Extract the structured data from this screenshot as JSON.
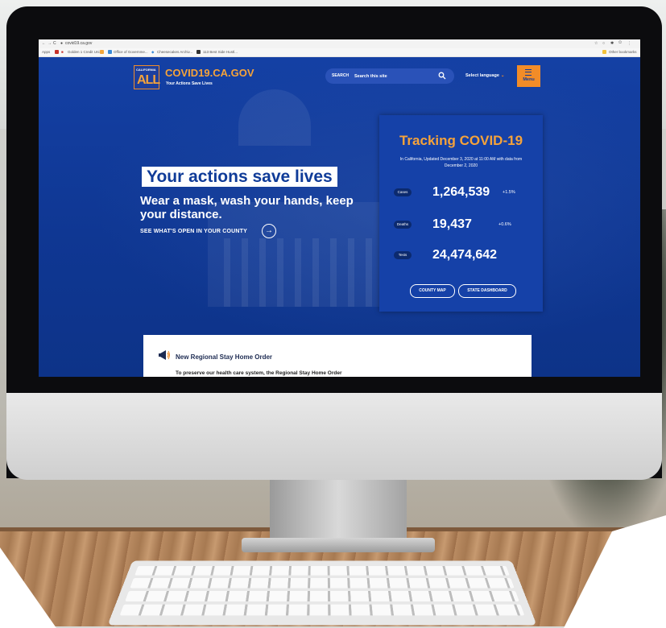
{
  "browser": {
    "url": "covid19.ca.gov",
    "bookmarks": [
      {
        "label": "Apps",
        "color": "#4a7bd6"
      },
      {
        "label": "Golden 1 Credit Uni...",
        "color": "#c7322b"
      },
      {
        "label": "Office of Governme...",
        "color": "#f2a63a"
      },
      {
        "label": "Cheesecakes Archiv...",
        "color": "#3a8ad6"
      },
      {
        "label": "113 Best Side Hustl...",
        "color": "#333333"
      }
    ],
    "other_bookmarks": "Other bookmarks"
  },
  "header": {
    "logo_small": "CALIFORNIA",
    "logo_big": "ALL",
    "site_title": "COVID19.CA.GOV",
    "tagline": "Your Actions Save Lives",
    "search_label": "SEARCH",
    "search_placeholder": "Search this site",
    "language_label": "Select language",
    "menu_label": "Menu"
  },
  "hero": {
    "title": "Your actions save lives",
    "subtitle": "Wear a mask, wash your hands, keep your distance.",
    "link": "SEE WHAT'S OPEN IN YOUR COUNTY"
  },
  "tracker": {
    "title": "Tracking COVID-19",
    "subtitle": "In California, Updated December 3, 2020 at 11:00 AM with data from December 2, 2020",
    "stats": [
      {
        "label": "Cases",
        "value": "1,264,539",
        "change": "+1.5%"
      },
      {
        "label": "Deaths",
        "value": "19,437",
        "change": "+0.6%"
      },
      {
        "label": "Tests",
        "value": "24,474,642",
        "change": ""
      }
    ],
    "buttons": [
      "COUNTY MAP",
      "STATE DASHBOARD"
    ]
  },
  "alert": {
    "title": "New Regional Stay Home Order",
    "text": "To preserve our health care system, the Regional Stay Home Order"
  },
  "colors": {
    "brand_blue": "#0f3b98",
    "accent_orange": "#f28c28"
  }
}
